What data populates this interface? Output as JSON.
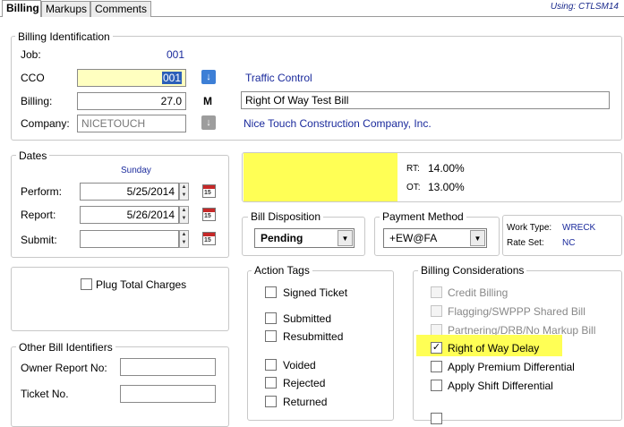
{
  "tabs": [
    {
      "label": "Billing",
      "active": true
    },
    {
      "label": "Markups",
      "active": false
    },
    {
      "label": "Comments",
      "active": false
    }
  ],
  "using_label": "Using: CTLSM14",
  "billing_id": {
    "legend": "Billing Identification",
    "job_label": "Job:",
    "job_value": "001",
    "cco_label": "CCO",
    "cco_value": "001",
    "cco_desc": "Traffic Control",
    "billing_label": "Billing:",
    "billing_value": "27.0",
    "billing_flag": "M",
    "billing_desc": "Right Of Way Test Bill",
    "company_label": "Company:",
    "company_value": "NICETOUCH",
    "company_desc": "Nice Touch Construction Company, Inc."
  },
  "dates": {
    "legend": "Dates",
    "day_name": "Sunday",
    "perform_label": "Perform:",
    "perform_value": "5/25/2014",
    "report_label": "Report:",
    "report_value": "5/26/2014",
    "submit_label": "Submit:",
    "submit_value": ""
  },
  "rates": {
    "rt_label": "RT:",
    "rt_value": "14.00%",
    "ot_label": "OT:",
    "ot_value": "13.00%"
  },
  "bill_disposition": {
    "legend": "Bill Disposition",
    "value": "Pending"
  },
  "payment_method": {
    "legend": "Payment Method",
    "value": "+EW@FA"
  },
  "work_info": {
    "work_type_label": "Work Type:",
    "work_type_value": "WRECK",
    "rate_set_label": "Rate Set:",
    "rate_set_value": "NC"
  },
  "plug_total": {
    "label": "Plug Total Charges",
    "checked": false
  },
  "action_tags": {
    "legend": "Action Tags",
    "items": [
      {
        "label": "Signed Ticket",
        "checked": false
      },
      {
        "label": "Submitted",
        "checked": false
      },
      {
        "label": "Resubmitted",
        "checked": false
      },
      {
        "label": "Voided",
        "checked": false
      },
      {
        "label": "Rejected",
        "checked": false
      },
      {
        "label": "Returned",
        "checked": false
      }
    ]
  },
  "billing_considerations": {
    "legend": "Billing Considerations",
    "items": [
      {
        "label": "Credit Billing",
        "checked": false,
        "enabled": false
      },
      {
        "label": "Flagging/SWPPP Shared Bill",
        "checked": false,
        "enabled": false
      },
      {
        "label": "Partnering/DRB/No Markup Bill",
        "checked": false,
        "enabled": false
      },
      {
        "label": "Right of Way Delay",
        "checked": true,
        "enabled": true
      },
      {
        "label": "Apply Premium Differential",
        "checked": false,
        "enabled": true
      },
      {
        "label": "Apply Shift Differential",
        "checked": false,
        "enabled": true
      }
    ]
  },
  "other_ids": {
    "legend": "Other Bill Identifiers",
    "owner_report_label": "Owner Report No:",
    "owner_report_value": "",
    "ticket_label": "Ticket No.",
    "ticket_value": ""
  },
  "icons": {
    "calendar": "calendar-icon",
    "arrow_down": "arrow-down-icon",
    "spin": "spin-updown-icon"
  },
  "colors": {
    "highlight": "#ffff55",
    "input_yellow": "#ffffc0",
    "link_blue": "#1a2a9c",
    "selection": "#2b5fb8"
  }
}
